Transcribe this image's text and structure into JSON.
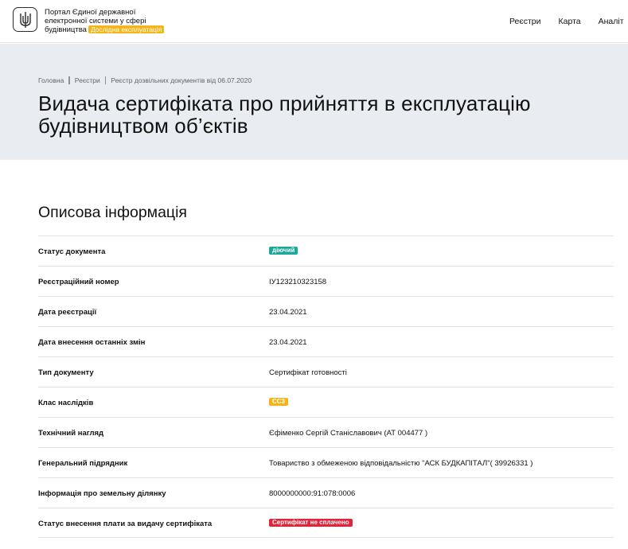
{
  "header": {
    "brand_line1": "Портал Єдиної державної",
    "brand_line2": "електронної системи у сфері",
    "brand_line3": "будівництва",
    "test_badge": "Дослідна експлуатація",
    "nav": [
      "Реєстри",
      "Карта",
      "Аналіт"
    ]
  },
  "breadcrumb": [
    "Головна",
    "Реєстри",
    "Реєстр дозвільних документів від 06.07.2020"
  ],
  "page_title_line1": "Видача сертифіката про прийняття в експлуатацію",
  "page_title_line2": "будівництвом об’єктів",
  "section_title": "Описова інформація",
  "rows": [
    {
      "label": "Статус документа",
      "value": "діючий",
      "type": "tag",
      "color": "#1aa89a"
    },
    {
      "label": "Реєстраційний номер",
      "value": "ІУ123210323158"
    },
    {
      "label": "Дата реєстрації",
      "value": "23.04.2021"
    },
    {
      "label": "Дата внесення останніх змін",
      "value": "23.04.2021"
    },
    {
      "label": "Тип документу",
      "value": "Сертифікат готовності"
    },
    {
      "label": "Клас наслідків",
      "value": "СС3",
      "type": "tag",
      "color": "#f5b51a"
    },
    {
      "label": "Технічний нагляд",
      "value": "Єфіменко Сергій Станіславович (АТ 004477 )"
    },
    {
      "label": "Генеральний підрядник",
      "value": "Товариство з обмеженою відповідальністю \"АСК БУДКАПІТАЛ\"( 39926331 )"
    },
    {
      "label": "Інформація про земельну ділянку",
      "value": "8000000000:91:078:0006"
    },
    {
      "label": "Статус внесення плати за видачу сертифіката",
      "value": "Сертифікат не сплачено",
      "type": "tag",
      "color": "#e0243a"
    }
  ]
}
